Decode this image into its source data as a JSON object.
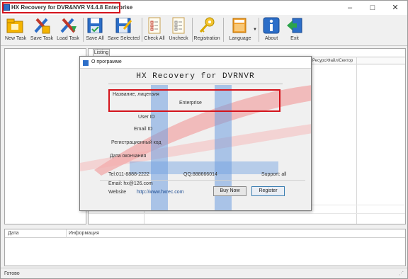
{
  "window": {
    "title": "HX Recovery for DVR&NVR V4.4.8 Enterprise"
  },
  "toolbar": {
    "items": [
      {
        "label": "New Task",
        "icon": "folder-new-icon"
      },
      {
        "label": "Save Task",
        "icon": "tools-save-icon"
      },
      {
        "label": "Load Task",
        "icon": "tools-load-icon"
      },
      {
        "label": "Save All",
        "icon": "save-all-icon"
      },
      {
        "label": "Save Selected",
        "icon": "save-selected-icon"
      },
      {
        "label": "Check All",
        "icon": "check-all-icon"
      },
      {
        "label": "Uncheck",
        "icon": "uncheck-icon"
      },
      {
        "label": "Registration",
        "icon": "key-icon"
      },
      {
        "label": "Language",
        "icon": "language-icon"
      },
      {
        "label": "About",
        "icon": "info-icon"
      },
      {
        "label": "Exit",
        "icon": "exit-icon"
      }
    ]
  },
  "main": {
    "tab_label": "Listing",
    "grid_header_right": "Ресурс/Файл/Сектор"
  },
  "log": {
    "columns": [
      "Дата",
      "Информация"
    ]
  },
  "status": {
    "text": "Готово"
  },
  "dialog": {
    "title": "О программе",
    "product": "HX Recovery for DVRNVR",
    "license_label": "Название, лицензия",
    "license_value": "Enterprise",
    "user_id_label": "User ID",
    "email_id_label": "Email ID",
    "reg_code_label": "Регистрационный код",
    "expire_label": "Дата окончания",
    "tel": "Tel:011-8888-2222",
    "qq": "QQ:888666014",
    "support": "Support: all",
    "email": "Email: hx@126.com",
    "website_label": "Website",
    "website_value": "http://www.hxrec.com",
    "buy_label": "Buy Now",
    "register_label": "Register"
  },
  "colors": {
    "highlight": "#d4141c",
    "toolbar_blue": "#2c6ec8"
  }
}
